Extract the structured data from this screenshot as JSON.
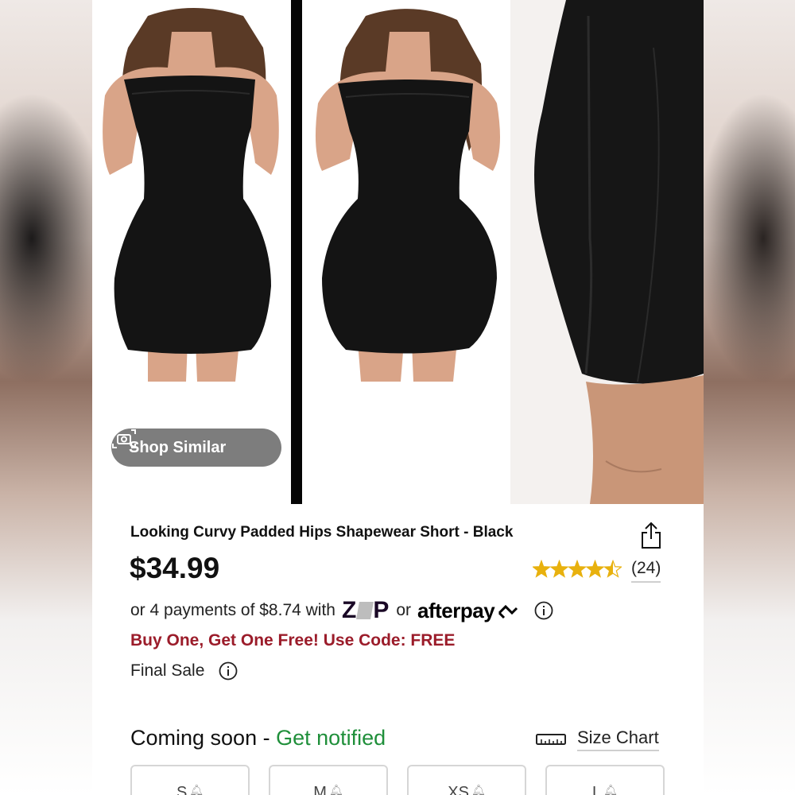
{
  "gallery": {
    "shop_similar_label": "Shop Similar"
  },
  "product": {
    "title": "Looking Curvy Padded Hips Shapewear Short - Black",
    "price": "$34.99",
    "rating": 4.5,
    "review_count": "(24)",
    "star_color": "#e8b10e"
  },
  "payments": {
    "prefix": "or 4 payments of $8.74 with",
    "zip_logo": "ZIP",
    "or": "or",
    "afterpay_logo": "afterpay"
  },
  "promo": {
    "text": "Buy One, Get One Free! Use Code: FREE",
    "color": "#9b1c2a"
  },
  "final_sale": {
    "label": "Final Sale"
  },
  "availability": {
    "coming_soon": "Coming soon",
    "separator": " - ",
    "get_notified": "Get notified",
    "notify_color": "#1f8f3a"
  },
  "size_chart": {
    "label": "Size Chart"
  },
  "sizes": [
    {
      "label": "S"
    },
    {
      "label": "M"
    },
    {
      "label": "XS"
    },
    {
      "label": "L"
    }
  ]
}
